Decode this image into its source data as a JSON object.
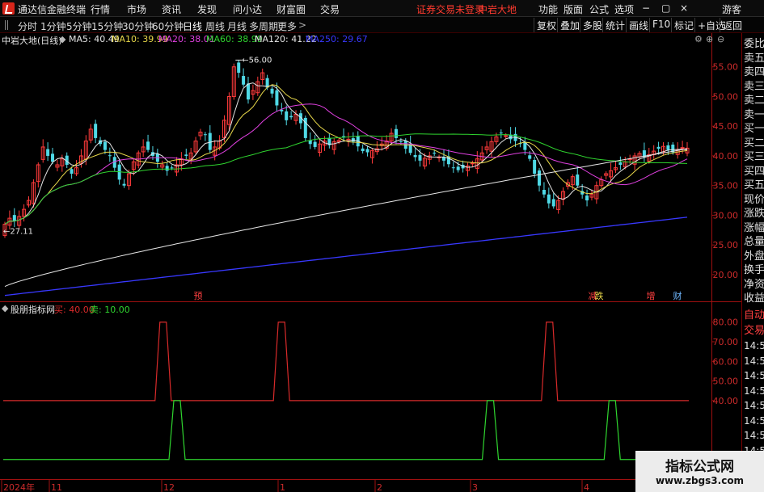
{
  "app": {
    "title": "通达信金融终端",
    "menu": [
      "行情",
      "市场",
      "资讯",
      "发现",
      "问小达",
      "财富圈",
      "交易"
    ],
    "notice": "证券交易未登录",
    "stock_header": "中岩大地",
    "right_menu": [
      "功能",
      "版面",
      "公式",
      "选项"
    ],
    "guest": "游客",
    "window_controls": [
      "−",
      "▢",
      "×"
    ]
  },
  "toolbar": {
    "periods": [
      "分时",
      "1分钟",
      "5分钟",
      "15分钟",
      "30分钟",
      "60分钟",
      "日线",
      "周线",
      "月线",
      "多周期",
      "更多"
    ],
    "active_period": "日线",
    "more_arrow": ">",
    "buttons": [
      "复权",
      "叠加",
      "多股",
      "统计",
      "画线",
      "F10",
      "标记",
      "+自选",
      "返回"
    ]
  },
  "main_chart": {
    "stock_label": "中岩大地(日线)",
    "ma_legend": [
      {
        "label": "MA5: 40.49",
        "color": "#e6e6e6"
      },
      {
        "label": "MA10: 39.99",
        "color": "#e8d84a"
      },
      {
        "label": "MA20: 38.01",
        "color": "#e040e0"
      },
      {
        "label": "MA60: 38.99",
        "color": "#2fd52f"
      },
      {
        "label": "MA120: 41.22",
        "color": "#e6e6e6"
      },
      {
        "label": "MA250: 29.67",
        "color": "#3838ff"
      }
    ],
    "high_label": "56.00",
    "low_label": "27.11",
    "event_markers": [
      {
        "label": "预",
        "color": "#ff4040"
      },
      {
        "label": "减",
        "color": "#ff4040"
      },
      {
        "label": "跌",
        "color": "#e8d84a"
      },
      {
        "label": "增",
        "color": "#ff4040"
      },
      {
        "label": "财",
        "color": "#6fb7ff"
      }
    ]
  },
  "sub_chart": {
    "indicator_name": "股朋指标网",
    "buy_label": "买: 40.00",
    "sell_label": "卖: 10.00",
    "buy_color": "#d82a2a",
    "sell_color": "#2fd52f"
  },
  "x_axis": {
    "labels": [
      "2024年",
      "11",
      "12",
      "1",
      "2",
      "3",
      "4"
    ]
  },
  "right_panel": {
    "top_items": [
      "委比",
      "卖五",
      "卖四",
      "卖三",
      "卖二",
      "卖一",
      "买一",
      "买二",
      "买三",
      "买四",
      "买五",
      "现价",
      "涨跌",
      "涨幅",
      "总量",
      "外盘",
      "换手",
      "净资",
      "收益"
    ],
    "bottom_items": [
      "自动",
      "交易",
      "14:56",
      "14:56",
      "14:56",
      "14:56",
      "14:56",
      "14:56",
      "14:56",
      "14:56",
      "14:56"
    ]
  },
  "watermark": {
    "title": "指标公式网",
    "url": "www.zbgs3.com"
  },
  "chart_data": [
    {
      "type": "candlestick",
      "title": "中岩大地(日线)",
      "y_ticks": [
        20.0,
        25.0,
        30.0,
        35.0,
        40.0,
        45.0,
        50.0,
        55.0
      ],
      "ylim": [
        15.5,
        58.5
      ],
      "candle_count": 144,
      "closes": [
        28.5,
        29.5,
        29.0,
        29.8,
        31.0,
        32.5,
        35.5,
        38.5,
        41.5,
        40.0,
        39.0,
        38.5,
        39.5,
        38.5,
        37.0,
        38.0,
        40.0,
        42.5,
        44.5,
        43.0,
        42.0,
        41.0,
        40.0,
        38.0,
        36.0,
        35.0,
        37.0,
        39.0,
        40.5,
        41.5,
        41.0,
        40.0,
        39.0,
        38.5,
        37.5,
        38.0,
        38.5,
        39.5,
        40.0,
        40.5,
        42.5,
        44.0,
        43.5,
        41.0,
        41.5,
        42.5,
        46.0,
        50.0,
        55.0,
        54.0,
        52.0,
        49.5,
        51.0,
        52.5,
        54.0,
        51.5,
        50.5,
        48.5,
        47.5,
        46.0,
        46.5,
        47.0,
        45.5,
        43.0,
        42.0,
        41.5,
        42.0,
        42.5,
        41.8,
        42.4,
        42.6,
        43.1,
        42.8,
        42.4,
        41.6,
        40.8,
        40.6,
        40.9,
        41.2,
        42.0,
        42.5,
        43.8,
        43.0,
        42.4,
        41.2,
        40.5,
        39.8,
        39.2,
        39.6,
        40.0,
        40.4,
        39.8,
        39.2,
        38.6,
        38.0,
        37.6,
        37.9,
        38.3,
        38.8,
        39.5,
        40.5,
        41.5,
        42.4,
        43.2,
        43.8,
        43.4,
        42.8,
        42.5,
        42.0,
        41.0,
        39.5,
        37.0,
        35.0,
        33.5,
        32.0,
        31.5,
        32.5,
        34.0,
        35.5,
        36.5,
        35.0,
        33.5,
        32.5,
        33.5,
        35.0,
        36.0,
        37.0,
        37.5,
        38.0,
        38.5,
        39.0,
        39.5,
        40.0,
        40.4,
        39.8,
        40.2,
        40.8,
        41.2,
        41.6,
        41.0,
        40.6,
        41.0,
        41.4,
        41.3
      ],
      "high_label": 56.0,
      "low_label": 27.11
    },
    {
      "type": "line",
      "title": "股朋指标网",
      "y_ticks": [
        40.0,
        50.0,
        60.0,
        70.0,
        80.0
      ],
      "ylim": [
        0,
        84
      ],
      "series": [
        {
          "name": "买",
          "baseline": 40.0,
          "peak": 80.0,
          "peaks": [
            "2024-11-22",
            "2024-12-26",
            "2025-03-13"
          ]
        },
        {
          "name": "卖",
          "baseline": 10.0,
          "peak": 40.0,
          "peaks": [
            "2024-11-26",
            "2025-02-24",
            "2025-03-31"
          ]
        }
      ]
    }
  ]
}
